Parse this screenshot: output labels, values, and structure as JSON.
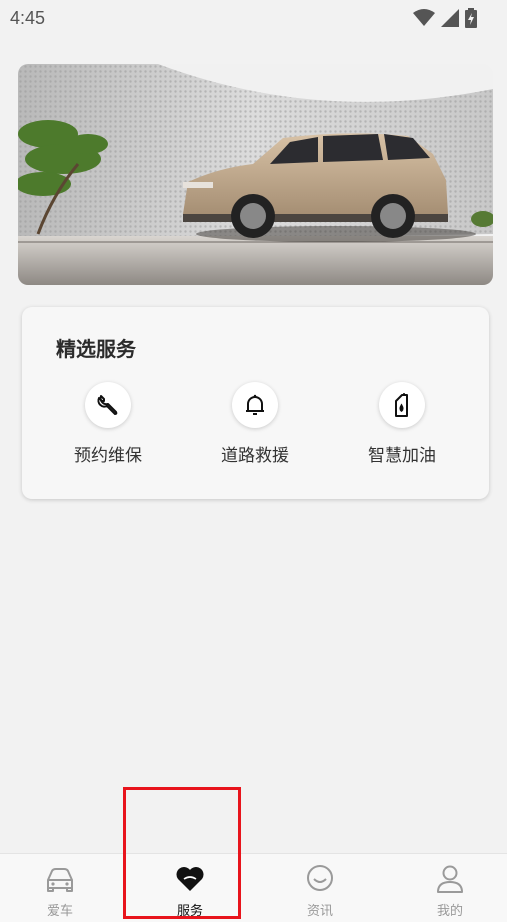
{
  "status_bar": {
    "time": "4:45"
  },
  "hero": {
    "image_alt": ""
  },
  "services": {
    "title": "精选服务",
    "items": [
      {
        "label": "预约维保",
        "icon": "wrench-icon"
      },
      {
        "label": "道路救援",
        "icon": "bell-icon"
      },
      {
        "label": "智慧加油",
        "icon": "fuel-can-icon"
      }
    ]
  },
  "tabbar": {
    "items": [
      {
        "label": "爱车",
        "icon": "car-icon"
      },
      {
        "label": "服务",
        "icon": "heart-icon",
        "active": true
      },
      {
        "label": "资讯",
        "icon": "chat-icon"
      },
      {
        "label": "我的",
        "icon": "person-icon"
      }
    ]
  },
  "colors": {
    "highlight": "#e8141c",
    "active_tab": "#111111",
    "inactive_tab": "#999999"
  }
}
